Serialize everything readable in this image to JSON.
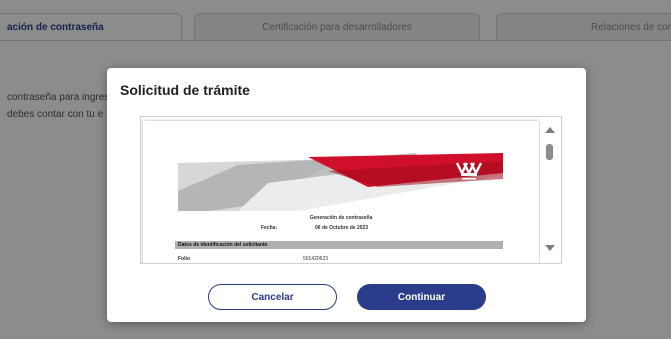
{
  "tabs": [
    {
      "label": "ación de contraseña",
      "active": true
    },
    {
      "label": "Certificación para desarrolladores",
      "active": false
    },
    {
      "label": "Relaciones de confi",
      "active": false
    }
  ],
  "background": {
    "line1": "contraseña para ingres",
    "line2": "debes contar con tu e"
  },
  "modal": {
    "title": "Solicitud de trámite",
    "cancel_label": "Cancelar",
    "continue_label": "Continuar"
  },
  "document": {
    "heading": "Generación de contraseña",
    "fecha_label": "Fecha:",
    "fecha_value": "06 de Octubre de 2023",
    "section_title": "Datos de identificación del solicitante",
    "folio_label": "Folio",
    "folio_value": "501420623"
  },
  "colors": {
    "primary": "#2b3c8a",
    "brand_red": "#d0102a"
  },
  "icons": {
    "logo": "infonavit-logo",
    "scroll_up": "triangle-up-icon",
    "scroll_down": "triangle-down-icon"
  }
}
